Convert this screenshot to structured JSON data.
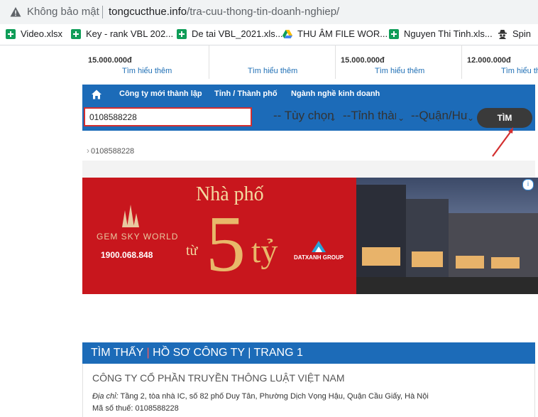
{
  "browser": {
    "security_label": "Không bảo mật",
    "url_domain": "tongcucthue.info",
    "url_path": "/tra-cuu-thong-tin-doanh-nghiep/",
    "bookmarks": [
      {
        "label": "Video.xlsx",
        "icon": "sheets-icon"
      },
      {
        "label": "Key - rank VBL 202...",
        "icon": "sheets-icon"
      },
      {
        "label": "De tai VBL_2021.xls...",
        "icon": "sheets-icon"
      },
      {
        "label": "THU ÂM FILE WOR...",
        "icon": "drive-icon"
      },
      {
        "label": "Nguyen Thi Tinh.xls...",
        "icon": "sheets-icon"
      },
      {
        "label": "Spin",
        "icon": "spy-icon"
      }
    ]
  },
  "prices": [
    {
      "price": "15.000.000đ",
      "more": "Tìm hiểu thêm"
    },
    {
      "price": "",
      "more": "Tìm hiểu thêm"
    },
    {
      "price": "15.000.000đ",
      "more": "Tìm hiểu thêm"
    },
    {
      "price": "12.000.000đ",
      "more": "Tìm hiểu thêm"
    }
  ],
  "nav": {
    "items": [
      "Công ty mới thành lập",
      "Tỉnh / Thành phố",
      "Ngành nghề kinh doanh"
    ]
  },
  "search": {
    "value": "0108588228",
    "type_select": "-- Tùy chọn",
    "province_select": "--Tỉnh thành",
    "district_select": "--Quận/Huyện",
    "button_label": "TÌM"
  },
  "breadcrumb": "0108588228",
  "ad": {
    "brand": "GEM SKY WORLD",
    "phone": "1900.068.848",
    "headline": "Nhà phố",
    "from": "từ",
    "amount": "5",
    "unit": "tỷ",
    "developer": "DATXANH GROUP"
  },
  "results": {
    "header_found": "TÌM THẤY",
    "header_divider": "|",
    "header_rest": "HỒ SƠ CÔNG TY | TRANG 1",
    "company_name": "CÔNG TY CỔ PHẦN TRUYỀN THÔNG LUẬT VIỆT NAM",
    "address_label": "Địa chỉ:",
    "address": "Tầng 2, tòa nhà IC, số 82 phố Duy Tân, Phường Dịch Vọng Hậu, Quận Cầu Giấy, Hà Nội",
    "tax_label": "Mã số thuế:",
    "tax_code": "0108588228"
  },
  "colors": {
    "nav_blue": "#1c6bb8",
    "highlight_red": "#d32f2f",
    "button_dark": "#3a3a3a"
  }
}
